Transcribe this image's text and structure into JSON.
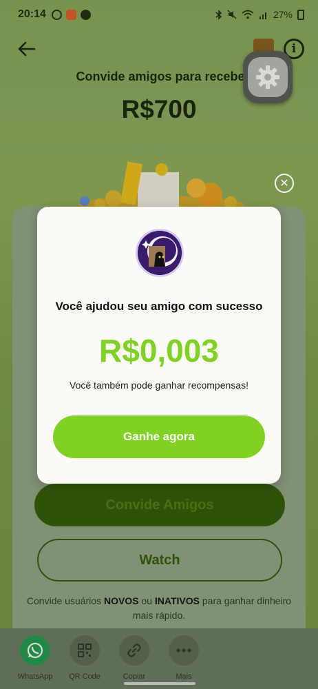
{
  "status_bar": {
    "time": "20:14",
    "battery": "27%"
  },
  "header": {
    "headline": "Convide amigos para recebe",
    "amount": "R$700",
    "info_symbol": "i"
  },
  "background": {
    "invite_button": "Convide Amigos",
    "watch_button": "Watch",
    "hint_prefix": "Convide usuários ",
    "hint_new": "NOVOS",
    "hint_or": " ou ",
    "hint_inactive": "INATIVOS",
    "hint_suffix": " para ganhar dinheiro mais rápido."
  },
  "share_bar": {
    "items": [
      {
        "label": "WhatsApp",
        "icon": "whatsapp-icon",
        "color": "#25d366"
      },
      {
        "label": "QR Code",
        "icon": "qr-code-icon"
      },
      {
        "label": "Copiar",
        "icon": "link-icon"
      },
      {
        "label": "Mais",
        "icon": "more-icon"
      }
    ]
  },
  "modal": {
    "title": "Você ajudou seu amigo com sucesso",
    "value": "R$0,003",
    "subtitle": "Você também pode ganhar recompensas!",
    "cta_label": "Ganhe agora",
    "close_symbol": "✕"
  },
  "colors": {
    "accent_green": "#7ed321",
    "dark_green": "#2f5a05",
    "modal_bg": "#fcfaf7"
  }
}
